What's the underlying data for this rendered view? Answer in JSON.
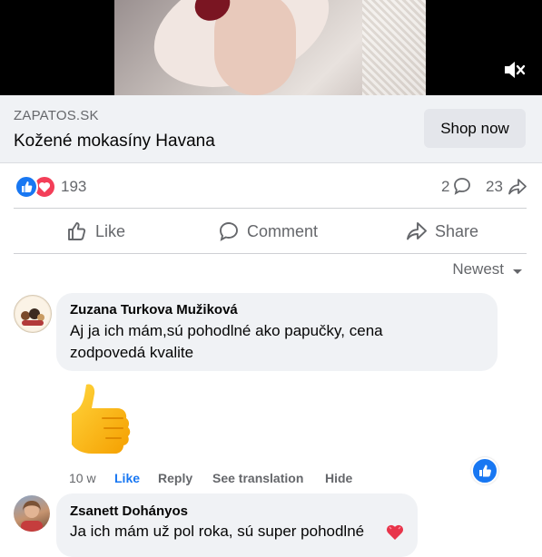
{
  "ad": {
    "domain": "ZAPATOS.SK",
    "title": "Kožené mokasíny Havana",
    "cta": "Shop now"
  },
  "stats": {
    "reactions": "193",
    "comments": "2",
    "shares": "23"
  },
  "actions": {
    "like": "Like",
    "comment": "Comment",
    "share": "Share"
  },
  "sort": {
    "label": "Newest"
  },
  "comments": [
    {
      "author": "Zuzana Turkova Mužiková",
      "text_line1": "Aj ja ich mám,sú pohodlné ako papučky, cena",
      "text_line2": "zodpovedá kvalite",
      "time": "10 w",
      "like": "Like",
      "reply": "Reply",
      "translate": "See translation",
      "hide": "Hide"
    },
    {
      "author": "Zsanett Dohányos",
      "text": "Ja ich mám už pol roka, sú super pohodlné"
    }
  ],
  "colors": {
    "facebook_blue": "#1877f2",
    "love_red": "#f33e58",
    "secondary_text": "#65676b",
    "bubble_bg": "#f0f2f5"
  }
}
